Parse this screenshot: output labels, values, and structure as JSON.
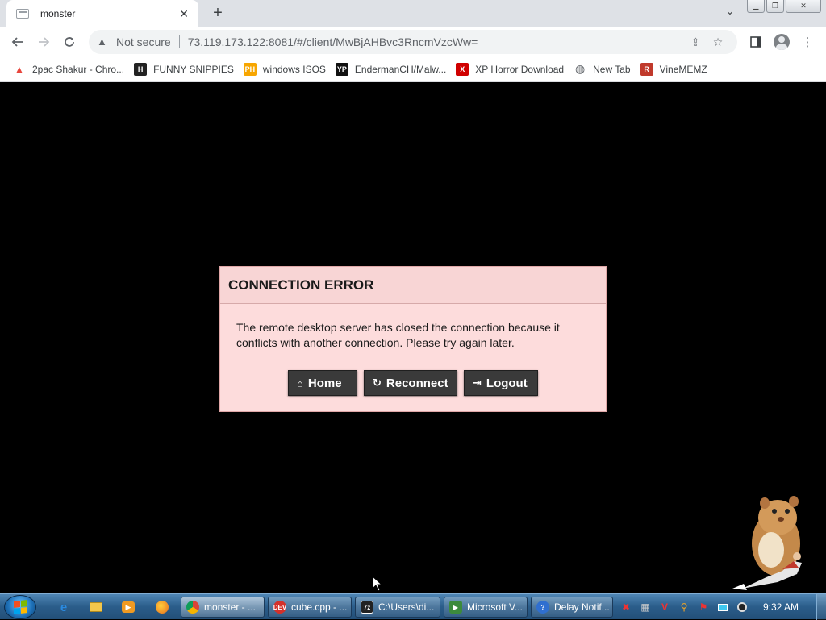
{
  "browser": {
    "tab_title": "monster",
    "tab_close": "✕",
    "new_tab": "+",
    "security_label": "Not secure",
    "url": "73.119.173.122:8081/#/client/MwBjAHBvc3RncmVzcWw="
  },
  "bookmarks": [
    {
      "label": "2pac Shakur - Chro...",
      "icon": "chrome-store-icon",
      "color": "#e8453c"
    },
    {
      "label": "FUNNY SNIPPIES",
      "icon": "h-icon",
      "color": "#222222"
    },
    {
      "label": "windows ISOS",
      "icon": "ph-icon",
      "color": "#f7a600"
    },
    {
      "label": "EndermanCH/Malw...",
      "icon": "yp-icon",
      "color": "#111111"
    },
    {
      "label": "XP Horror Download",
      "icon": "x-icon",
      "color": "#d00000"
    },
    {
      "label": "New Tab",
      "icon": "globe-icon",
      "color": "#5f6368"
    },
    {
      "label": "VineMEMZ",
      "icon": "r-icon",
      "color": "#c0392b"
    }
  ],
  "dialog": {
    "title": "CONNECTION ERROR",
    "message": "The remote desktop server has closed the connection because it conflicts with another connection. Please try again later.",
    "home_label": "Home",
    "reconnect_label": "Reconnect",
    "logout_label": "Logout"
  },
  "taskbar": {
    "tasks": [
      {
        "label": "monster - ...",
        "icon": "chrome-icon",
        "active": true
      },
      {
        "label": "cube.cpp - ...",
        "icon": "devcpp-icon",
        "active": false
      },
      {
        "label": "C:\\Users\\di...",
        "icon": "7zip-icon",
        "active": false
      },
      {
        "label": "Microsoft V...",
        "icon": "visual-studio-icon",
        "active": false
      },
      {
        "label": "Delay Notif...",
        "icon": "help-icon",
        "active": false
      }
    ],
    "clock": "9:32 AM"
  }
}
